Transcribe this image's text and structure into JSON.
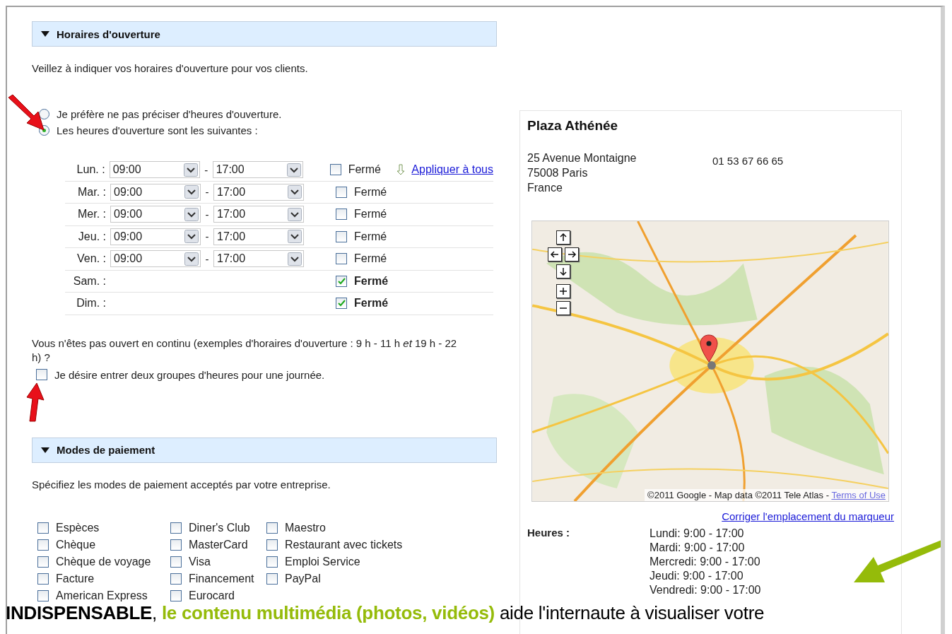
{
  "hours_section": {
    "title": "Horaires d'ouverture",
    "expanded": true,
    "intro": "Veillez à indiquer vos horaires d'ouverture pour vos clients.",
    "options": [
      {
        "label": "Je préfère ne pas préciser d'heures d'ouverture.",
        "selected": false
      },
      {
        "label": "Les heures d'ouverture sont les suivantes :",
        "selected": true
      }
    ],
    "apply_all": "Appliquer à tous",
    "days": [
      {
        "label": "Lun. :",
        "open": "09:00",
        "separator": "-",
        "close": "17:00",
        "closed_label": "Fermé",
        "closed": false
      },
      {
        "label": "Mar. :",
        "open": "09:00",
        "separator": "-",
        "close": "17:00",
        "closed_label": "Fermé",
        "closed": false
      },
      {
        "label": "Mer. :",
        "open": "09:00",
        "separator": "-",
        "close": "17:00",
        "closed_label": "Fermé",
        "closed": false
      },
      {
        "label": "Jeu. :",
        "open": "09:00",
        "separator": "-",
        "close": "17:00",
        "closed_label": "Fermé",
        "closed": false
      },
      {
        "label": "Ven. :",
        "open": "09:00",
        "separator": "-",
        "close": "17:00",
        "closed_label": "Fermé",
        "closed": false
      },
      {
        "label": "Sam. :",
        "closed_label": "Fermé",
        "closed": true
      },
      {
        "label": "Dim. :",
        "closed_label": "Fermé",
        "closed": true
      }
    ],
    "split_question": "Vous n'êtes pas ouvert en continu (exemples d'horaires d'ouverture : 9 h - 11 h *et* 19 h - 22 h) ?",
    "split_option": {
      "label": "Je désire entrer deux groupes d'heures pour une journée.",
      "checked": false
    }
  },
  "payment_section": {
    "title": "Modes de paiement",
    "expanded": true,
    "intro": "Spécifiez les modes de paiement acceptés par votre entreprise.",
    "columns": [
      [
        {
          "label": "Espèces",
          "checked": false
        },
        {
          "label": "Chèque",
          "checked": false
        },
        {
          "label": "Chèque de voyage",
          "checked": false
        },
        {
          "label": "Facture",
          "checked": false
        },
        {
          "label": "American Express",
          "checked": false
        }
      ],
      [
        {
          "label": "Diner's Club",
          "checked": false
        },
        {
          "label": "MasterCard",
          "checked": false
        },
        {
          "label": "Visa",
          "checked": false
        },
        {
          "label": "Financement",
          "checked": false
        },
        {
          "label": "Eurocard",
          "checked": false
        }
      ],
      [
        {
          "label": "Maestro",
          "checked": false
        },
        {
          "label": "Restaurant avec tickets",
          "checked": false
        },
        {
          "label": "Emploi Service",
          "checked": false
        },
        {
          "label": "PayPal",
          "checked": false
        }
      ]
    ]
  },
  "preview": {
    "name": "Plaza Athénée",
    "address_lines": [
      "25 Avenue Montaigne",
      "75008 Paris",
      "France"
    ],
    "phone": "01 53 67 66 65",
    "map": {
      "kind": "picture",
      "attribution": "©2011 Google - Map data ©2011 Tele Atlas - ",
      "terms_link": "Terms of Use"
    },
    "fix_marker_link": "Corriger l'emplacement du marqueur",
    "hours_label": "Heures :",
    "hours": [
      "Lundi: 9:00 - 17:00",
      "Mardi: 9:00 - 17:00",
      "Mercredi: 9:00 - 17:00",
      "Jeudi: 9:00 - 17:00",
      "Vendredi: 9:00 - 17:00"
    ]
  },
  "caption": [
    {
      "text": "INDISPENSABLE",
      "kind": "strong"
    },
    {
      "text": ", ",
      "kind": "plain"
    },
    {
      "text": "le contenu multimédia (photos, vidéos)",
      "kind": "highlight"
    },
    {
      "text": " aide l'internaute à visualiser votre",
      "kind": "plain"
    }
  ]
}
